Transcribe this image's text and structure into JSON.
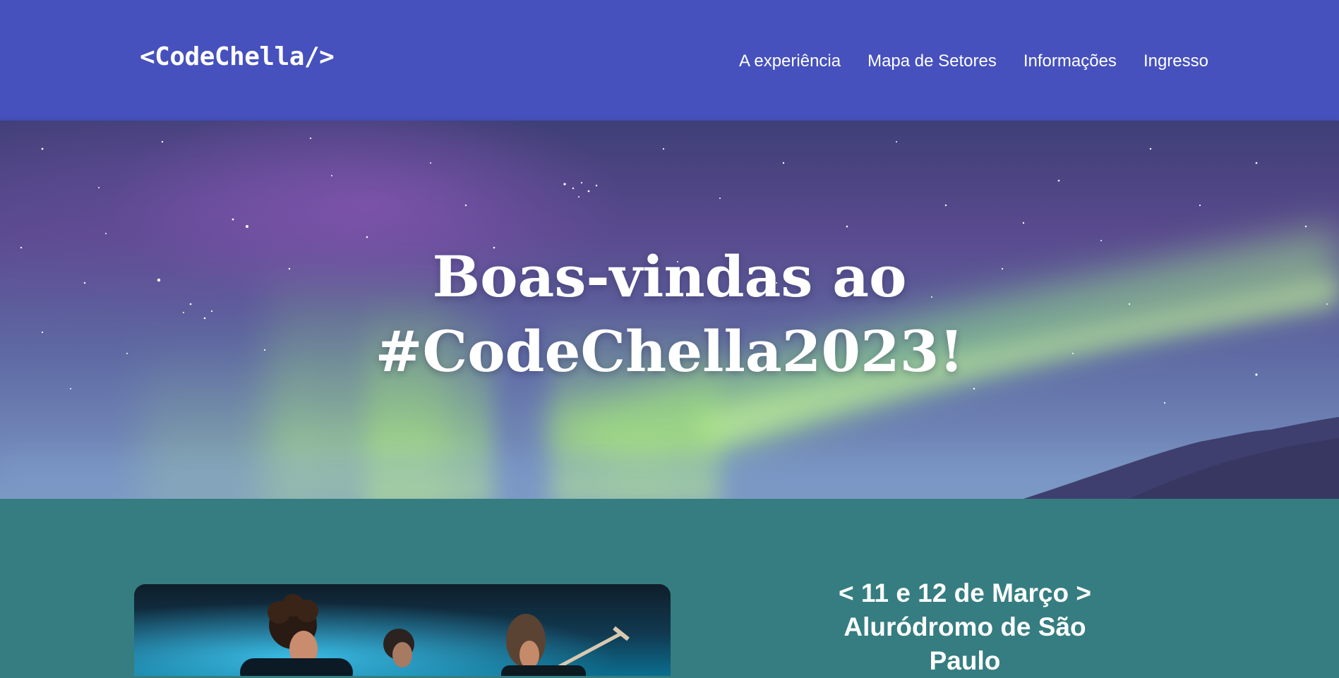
{
  "header": {
    "logo": "<CodeChella/>",
    "nav": [
      {
        "label": "A experiência"
      },
      {
        "label": "Mapa de Setores"
      },
      {
        "label": "Informações"
      },
      {
        "label": "Ingresso"
      }
    ],
    "background_color": "#4651bd"
  },
  "hero": {
    "title_line1": "Boas-vindas ao",
    "title_line2": "#CodeChella2023!"
  },
  "info": {
    "date": "< 11 e 12 de Março >",
    "venue_line1": "Aluródromo de São",
    "venue_line2": "Paulo",
    "background_color": "#357d80"
  }
}
